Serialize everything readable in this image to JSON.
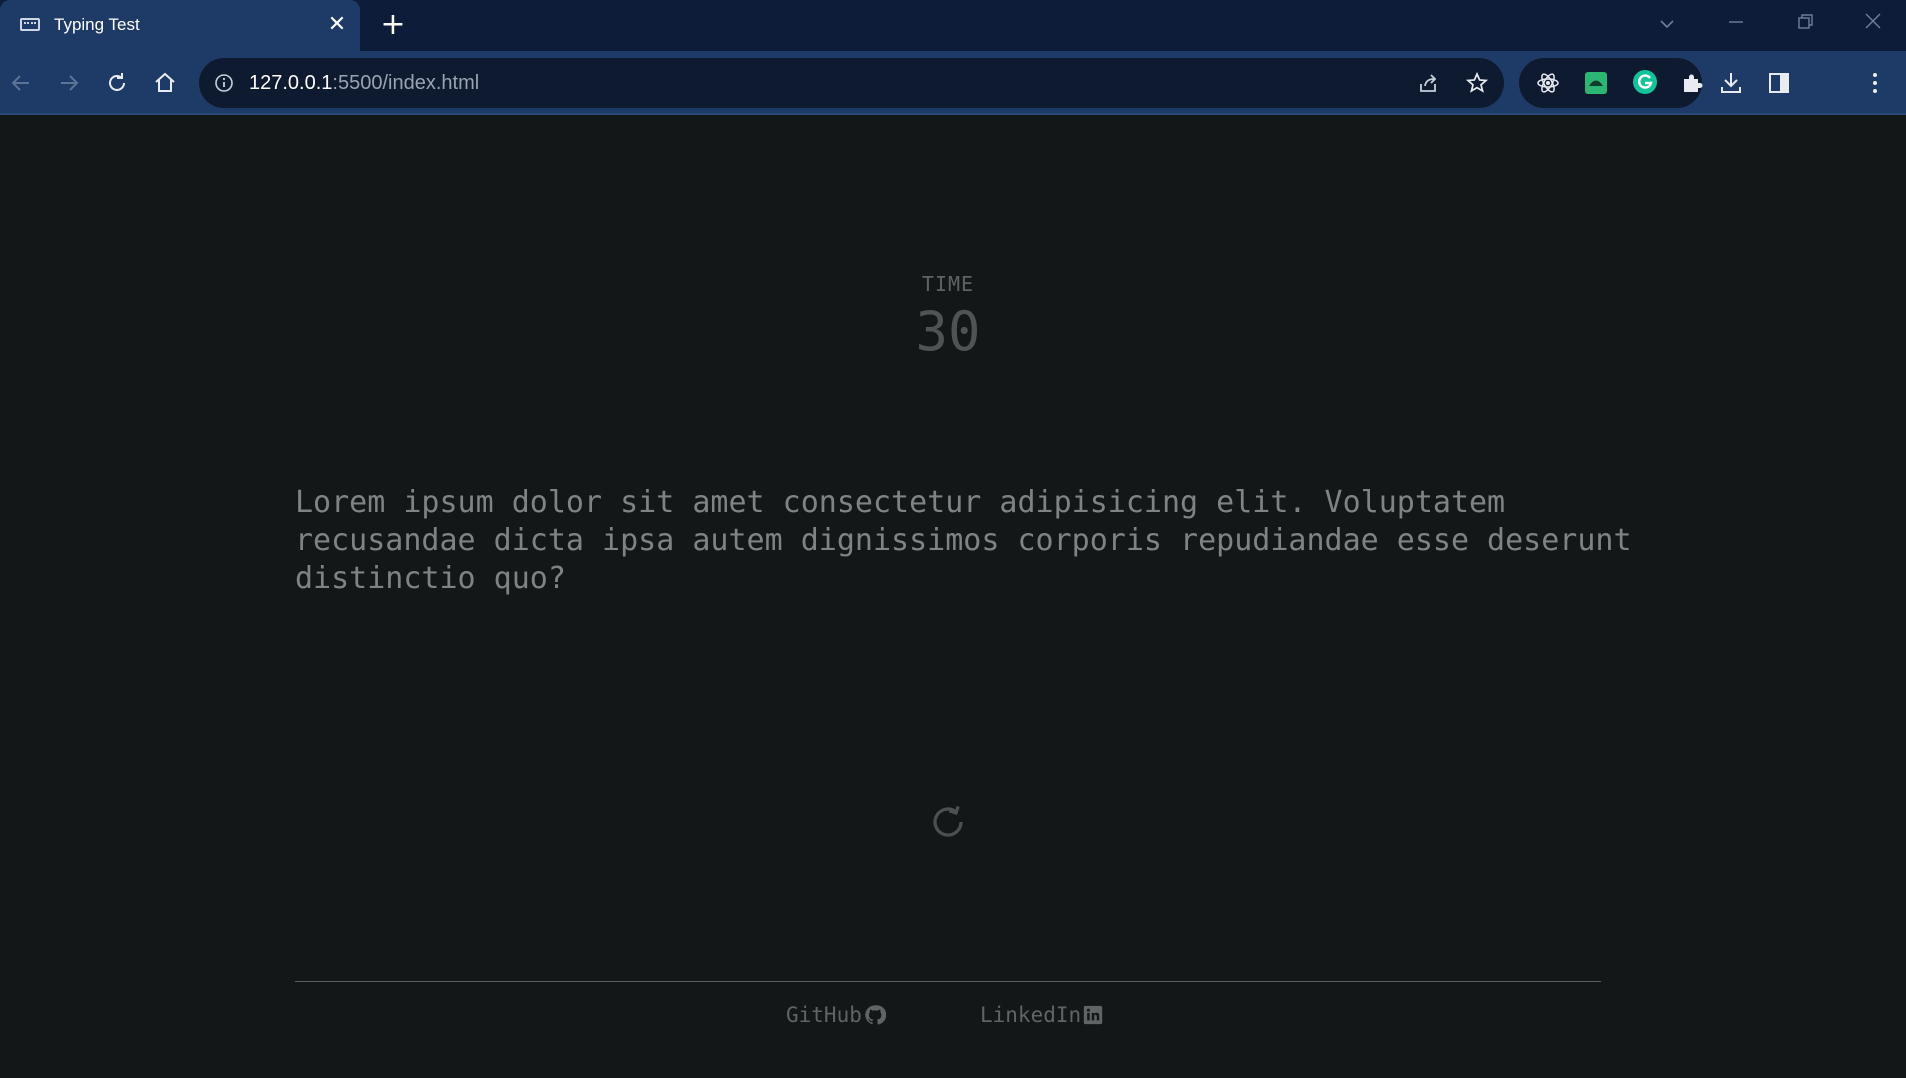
{
  "browser": {
    "tab_title": "Typing Test",
    "tab_close": "✕",
    "new_tab": "+",
    "url_host": "127.0.0.1",
    "url_rest": ":5500/index.html",
    "extension_badge": "off"
  },
  "timer": {
    "label": "TIME",
    "value": "30"
  },
  "quote": {
    "text": "Lorem ipsum dolor sit amet consectetur adipisicing elit. Voluptatem recusandae dicta ipsa autem dignissimos corporis repudiandae esse deserunt distinctio quo?"
  },
  "footer": {
    "github_label": "GitHub",
    "linkedin_label": "LinkedIn"
  },
  "icons": {
    "restart": "restart-icon",
    "github": "github-icon",
    "linkedin": "linkedin-icon"
  },
  "colors": {
    "page_background": "#141717",
    "text_muted": "#7e8384",
    "browser_frame": "#1e3a66"
  }
}
